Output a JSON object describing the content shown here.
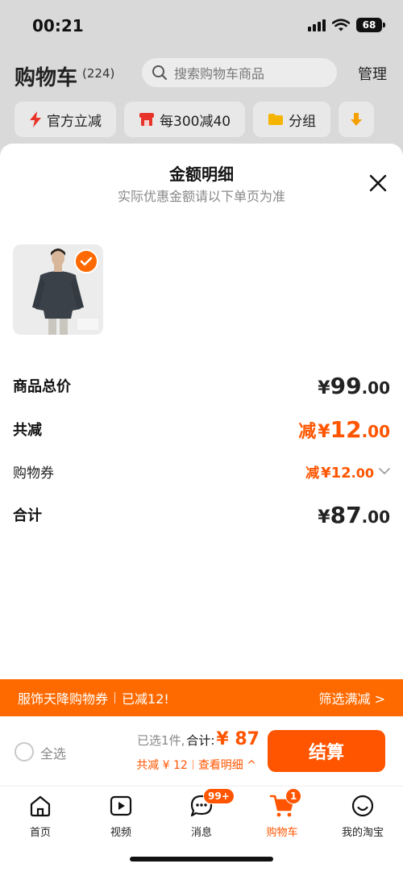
{
  "status_bar": {
    "time": "00:21",
    "battery": "68"
  },
  "cart_page": {
    "title": "购物车",
    "count": "(224)",
    "search_placeholder": "搜索购物车商品",
    "manage": "管理",
    "chips": [
      {
        "label": "官方立减",
        "icon": "lightning-icon"
      },
      {
        "label": "每300减40",
        "icon": "store-icon"
      },
      {
        "label": "分组",
        "icon": "folder-icon"
      }
    ]
  },
  "sheet": {
    "title": "金额明细",
    "subtitle": "实际优惠金额请以下单页为准",
    "rows": {
      "total_price": {
        "label": "商品总价",
        "yen": "¥",
        "int": "99",
        "dec": ".00"
      },
      "total_discount": {
        "label": "共减",
        "prefix": "减",
        "yen": "¥",
        "int": "12",
        "dec": ".00"
      },
      "coupon": {
        "label": "购物券",
        "prefix": "减",
        "yen": "¥",
        "int": "12",
        "dec": ".00"
      },
      "sum": {
        "label": "合计",
        "yen": "¥",
        "int": "87",
        "dec": ".00"
      }
    }
  },
  "promo": {
    "left_a": "服饰天降购物券",
    "left_b": "已减12!",
    "right": "筛选满减 >"
  },
  "checkout": {
    "select_all": "全选",
    "selected": "已选1件,",
    "total_label": "合计:",
    "total_value": "¥ 87",
    "discount": "共减 ¥ 12",
    "detail": "查看明细 ^",
    "pay": "结算"
  },
  "tabbar": {
    "items": [
      {
        "label": "首页",
        "icon": "home-icon"
      },
      {
        "label": "视频",
        "icon": "video-icon"
      },
      {
        "label": "消息",
        "icon": "message-icon",
        "badge": "99+"
      },
      {
        "label": "购物车",
        "icon": "cart-icon",
        "badge": "1",
        "active": true
      },
      {
        "label": "我的淘宝",
        "icon": "profile-icon"
      }
    ]
  },
  "colors": {
    "accent": "#ff5500",
    "promo": "#ff6a00"
  }
}
